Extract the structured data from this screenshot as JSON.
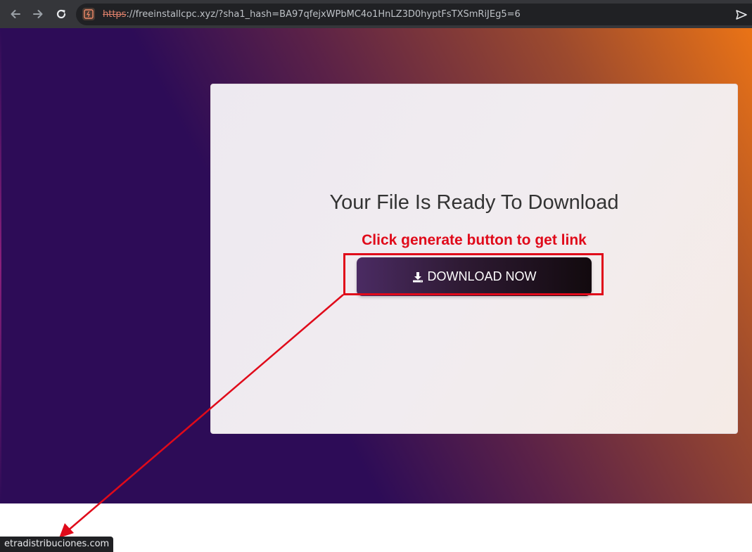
{
  "browser": {
    "url_scheme": "https",
    "url_rest": "://freeinstallcpc.xyz/?sha1_hash=BA97qfejxWPbMC4o1HnLZ3D0hyptFsTXSmRiJEg5=6",
    "status_url": "etradistribuciones.com"
  },
  "card": {
    "title": "Your File Is Ready To Download",
    "button_label": "DOWNLOAD NOW",
    "button_icon": "download-icon"
  },
  "annotation": {
    "text": "Click generate button to get link",
    "color": "#e00a1a"
  },
  "colors": {
    "bg_start": "#2d0c57",
    "bg_end": "#ea7316",
    "button_start": "#4b2b63",
    "button_end": "#120a0e"
  }
}
